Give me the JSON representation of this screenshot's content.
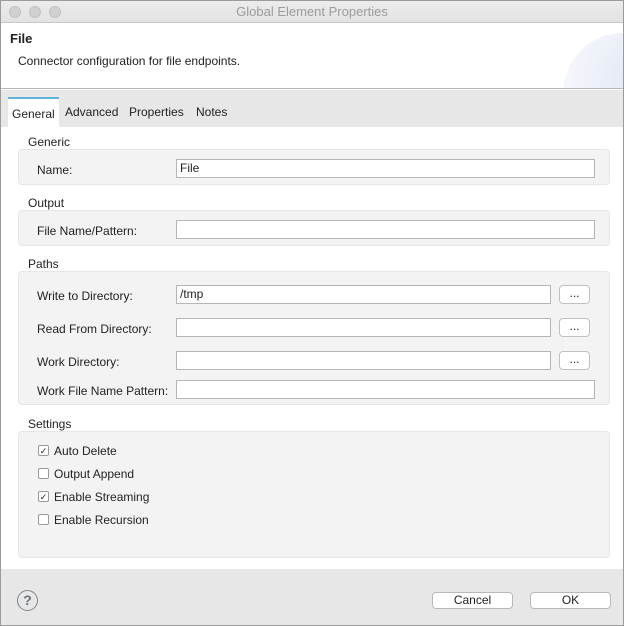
{
  "window": {
    "title": "Global Element Properties"
  },
  "header": {
    "title": "File",
    "description": "Connector configuration for file endpoints."
  },
  "tabs": [
    {
      "label": "General",
      "active": true
    },
    {
      "label": "Advanced"
    },
    {
      "label": "Properties"
    },
    {
      "label": "Notes"
    }
  ],
  "generic": {
    "section": "Generic",
    "name_label": "Name:",
    "name_value": "File"
  },
  "output": {
    "section": "Output",
    "pattern_label": "File Name/Pattern:",
    "pattern_value": ""
  },
  "paths": {
    "section": "Paths",
    "write_label": "Write to Directory:",
    "write_value": "/tmp",
    "read_label": "Read From Directory:",
    "read_value": "",
    "work_label": "Work Directory:",
    "work_value": "",
    "work_pattern_label": "Work File Name Pattern:",
    "work_pattern_value": "",
    "browse_label": "..."
  },
  "settings": {
    "section": "Settings",
    "items": [
      {
        "label": "Auto Delete",
        "checked": true
      },
      {
        "label": "Output Append",
        "checked": false
      },
      {
        "label": "Enable Streaming",
        "checked": true
      },
      {
        "label": "Enable Recursion",
        "checked": false
      }
    ],
    "check_mark": "✓"
  },
  "footer": {
    "help": "?",
    "cancel": "Cancel",
    "ok": "OK"
  },
  "colors": {
    "tab_accent": "#5fb3db"
  }
}
